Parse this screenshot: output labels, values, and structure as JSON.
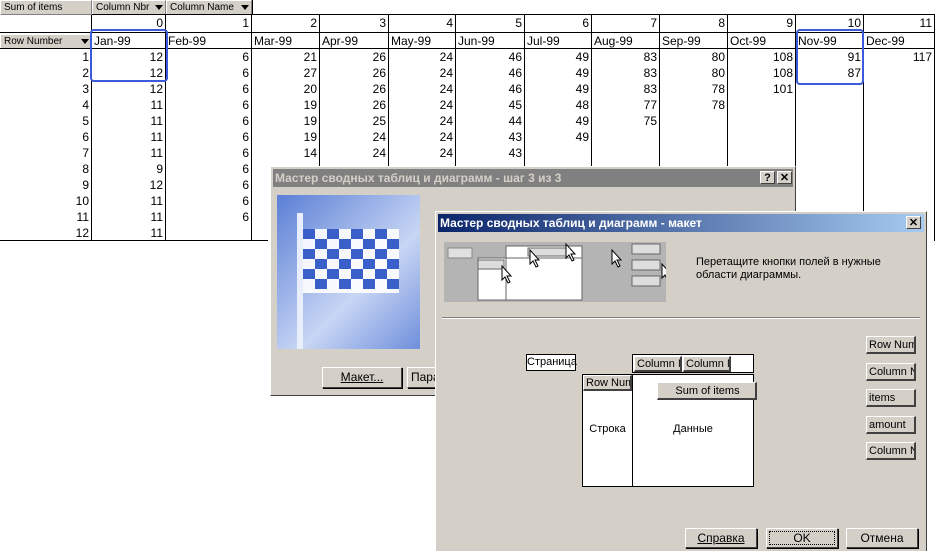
{
  "pivot": {
    "sum_label": "Sum of items",
    "column_nbr_label": "Column Nbr",
    "column_name_label": "Column Name",
    "row_number_label": "Row Number",
    "col_numbers": [
      "0",
      "1",
      "2",
      "3",
      "4",
      "5",
      "6",
      "7",
      "8",
      "9",
      "10",
      "11"
    ],
    "months": [
      "Jan-99",
      "Feb-99",
      "Mar-99",
      "Apr-99",
      "May-99",
      "Jun-99",
      "Jul-99",
      "Aug-99",
      "Sep-99",
      "Oct-99",
      "Nov-99",
      "Dec-99"
    ],
    "rows": [
      {
        "n": "1",
        "v": [
          "12",
          "6",
          "21",
          "26",
          "24",
          "46",
          "49",
          "83",
          "80",
          "108",
          "91",
          "117"
        ]
      },
      {
        "n": "2",
        "v": [
          "12",
          "6",
          "27",
          "26",
          "24",
          "46",
          "49",
          "83",
          "80",
          "108",
          "87",
          ""
        ]
      },
      {
        "n": "3",
        "v": [
          "12",
          "6",
          "20",
          "26",
          "24",
          "46",
          "49",
          "83",
          "78",
          "101",
          "",
          ""
        ]
      },
      {
        "n": "4",
        "v": [
          "11",
          "6",
          "19",
          "26",
          "24",
          "45",
          "48",
          "77",
          "78",
          "",
          "",
          ""
        ]
      },
      {
        "n": "5",
        "v": [
          "11",
          "6",
          "19",
          "25",
          "24",
          "44",
          "49",
          "75",
          "",
          "",
          "",
          ""
        ]
      },
      {
        "n": "6",
        "v": [
          "11",
          "6",
          "19",
          "24",
          "24",
          "43",
          "49",
          "",
          "",
          "",
          "",
          ""
        ]
      },
      {
        "n": "7",
        "v": [
          "11",
          "6",
          "14",
          "24",
          "24",
          "43",
          "",
          "",
          "",
          "",
          "",
          ""
        ]
      },
      {
        "n": "8",
        "v": [
          "9",
          "6",
          "",
          "",
          "",
          "",
          "",
          "",
          "",
          "",
          "",
          ""
        ]
      },
      {
        "n": "9",
        "v": [
          "12",
          "6",
          "",
          "",
          "",
          "",
          "",
          "",
          "",
          "",
          "",
          ""
        ]
      },
      {
        "n": "10",
        "v": [
          "11",
          "6",
          "",
          "",
          "",
          "",
          "",
          "",
          "",
          "",
          "",
          ""
        ]
      },
      {
        "n": "11",
        "v": [
          "11",
          "6",
          "",
          "",
          "",
          "",
          "",
          "",
          "",
          "",
          "",
          ""
        ]
      },
      {
        "n": "12",
        "v": [
          "11",
          "",
          "",
          "",
          "",
          "",
          "",
          "",
          "",
          "",
          "",
          ""
        ]
      }
    ]
  },
  "wizard": {
    "title": "Мастер сводных таблиц и диаграмм - шаг 3 из 3",
    "help_btn": "?",
    "close_btn": "✕",
    "layout_btn": "Макет...",
    "params_btn": "Пара"
  },
  "layout_dialog": {
    "title": "Мастер сводных таблиц и диаграмм - макет",
    "close_btn": "✕",
    "instruction": "Перетащите кнопки полей в нужные области диаграммы.",
    "page_label": "Страница",
    "col_field1": "Column Nl",
    "col_field2": "Column Nε",
    "row_field": "Row Numl",
    "row_area": "Строка",
    "data_field": "Sum of items",
    "data_area": "Данные",
    "fields": [
      "Row Numl",
      "Column Nε",
      "items",
      "amount",
      "Column Nl"
    ],
    "help_button": "Справка",
    "ok_button": "OK",
    "cancel_button": "Отмена"
  }
}
